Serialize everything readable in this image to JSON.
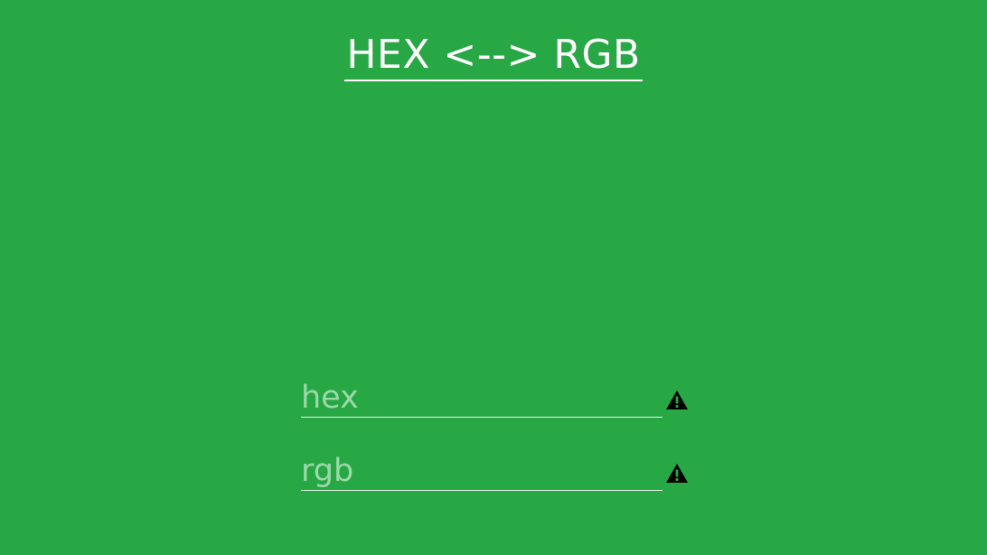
{
  "page": {
    "title": "HEX <--> RGB"
  },
  "fields": [
    {
      "name": "hex",
      "value": "",
      "placeholder": "hex",
      "status_icon": "warning-icon"
    },
    {
      "name": "rgb",
      "value": "",
      "placeholder": "rgb",
      "status_icon": "warning-icon"
    }
  ],
  "colors": {
    "background": "#28a745",
    "title_text": "#ffffff",
    "placeholder_text": "#9bd9a9",
    "input_underline": "#e6f4ea",
    "warning_icon": "#000000"
  }
}
